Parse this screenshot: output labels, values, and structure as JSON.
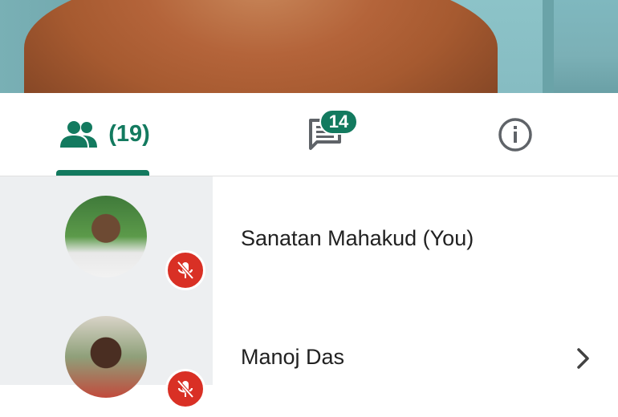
{
  "tabs": {
    "people_count": "(19)",
    "chat_badge": "14"
  },
  "participants": [
    {
      "name": "Sanatan Mahakud (You)",
      "muted": true
    },
    {
      "name": "Manoj Das",
      "muted": true
    }
  ],
  "icons": {
    "people": "people-icon",
    "chat": "chat-icon",
    "info": "info-icon",
    "mic_off": "mic-off-icon",
    "chevron": "chevron-right-icon"
  },
  "colors": {
    "accent": "#137a5f",
    "muted_red": "#d93025"
  }
}
